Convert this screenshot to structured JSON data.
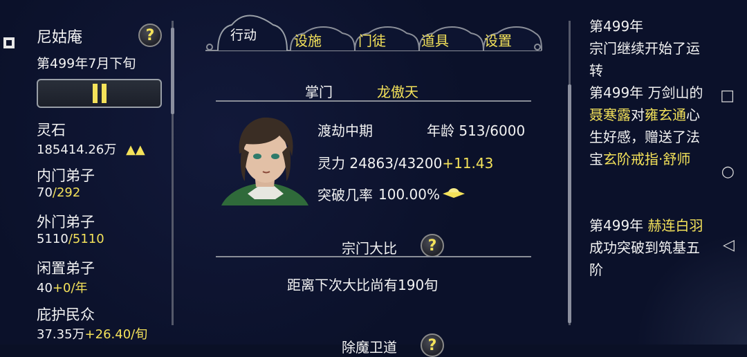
{
  "sect": {
    "name": "尼姑庵",
    "date": "第499年7月下旬",
    "help": "?"
  },
  "stats": [
    {
      "label": "灵石",
      "value": "185414.26万",
      "extra": "",
      "trend": "▲▲"
    },
    {
      "label": "内门弟子",
      "value": "70",
      "extra": "/292"
    },
    {
      "label": "外门弟子",
      "value": "5110",
      "extra": "/5110"
    },
    {
      "label": "闲置弟子",
      "value": "40",
      "extra": "+0/年"
    },
    {
      "label": "庇护民众",
      "value": "37.35万",
      "extra": "+26.40/旬"
    }
  ],
  "tabs": {
    "active": "行动",
    "items": [
      "设施",
      "门徒",
      "道具",
      "设置"
    ]
  },
  "leader": {
    "title_label": "掌门",
    "name": "龙傲天",
    "realm": "渡劫中期",
    "age_label": "年龄",
    "age": "513/6000",
    "power_label": "灵力",
    "power": "24863/43200",
    "power_gain": "+11.43",
    "breakthrough_label": "突破几率",
    "breakthrough": "100.00%"
  },
  "tournament": {
    "title": "宗门大比",
    "help": "?",
    "countdown": "距离下次大比尚有190旬"
  },
  "next_section": {
    "title": "除魔卫道",
    "help": "?"
  },
  "log": {
    "entry1": {
      "year": "第499年",
      "text1": "宗门继续开始了运",
      "text2": "转"
    },
    "entry2": {
      "year": "第499年",
      "place": "万剑山的",
      "person": "聂寒露",
      "mid": "对",
      "target": "雍玄通",
      "end": "心",
      "line3": "生好感，赠送了法",
      "line4_pre": "宝",
      "item": "玄阶戒指·舒师"
    },
    "entry3": {
      "year": "第499年",
      "person": "赫连白羽",
      "line2": "成功突破到筑基五",
      "line3": "阶"
    }
  },
  "system_buttons": [
    "□",
    "○",
    "◁"
  ],
  "colors": {
    "accent_yellow": "#f4e25a",
    "background": "#0b112a",
    "text": "#f2f2f2"
  }
}
